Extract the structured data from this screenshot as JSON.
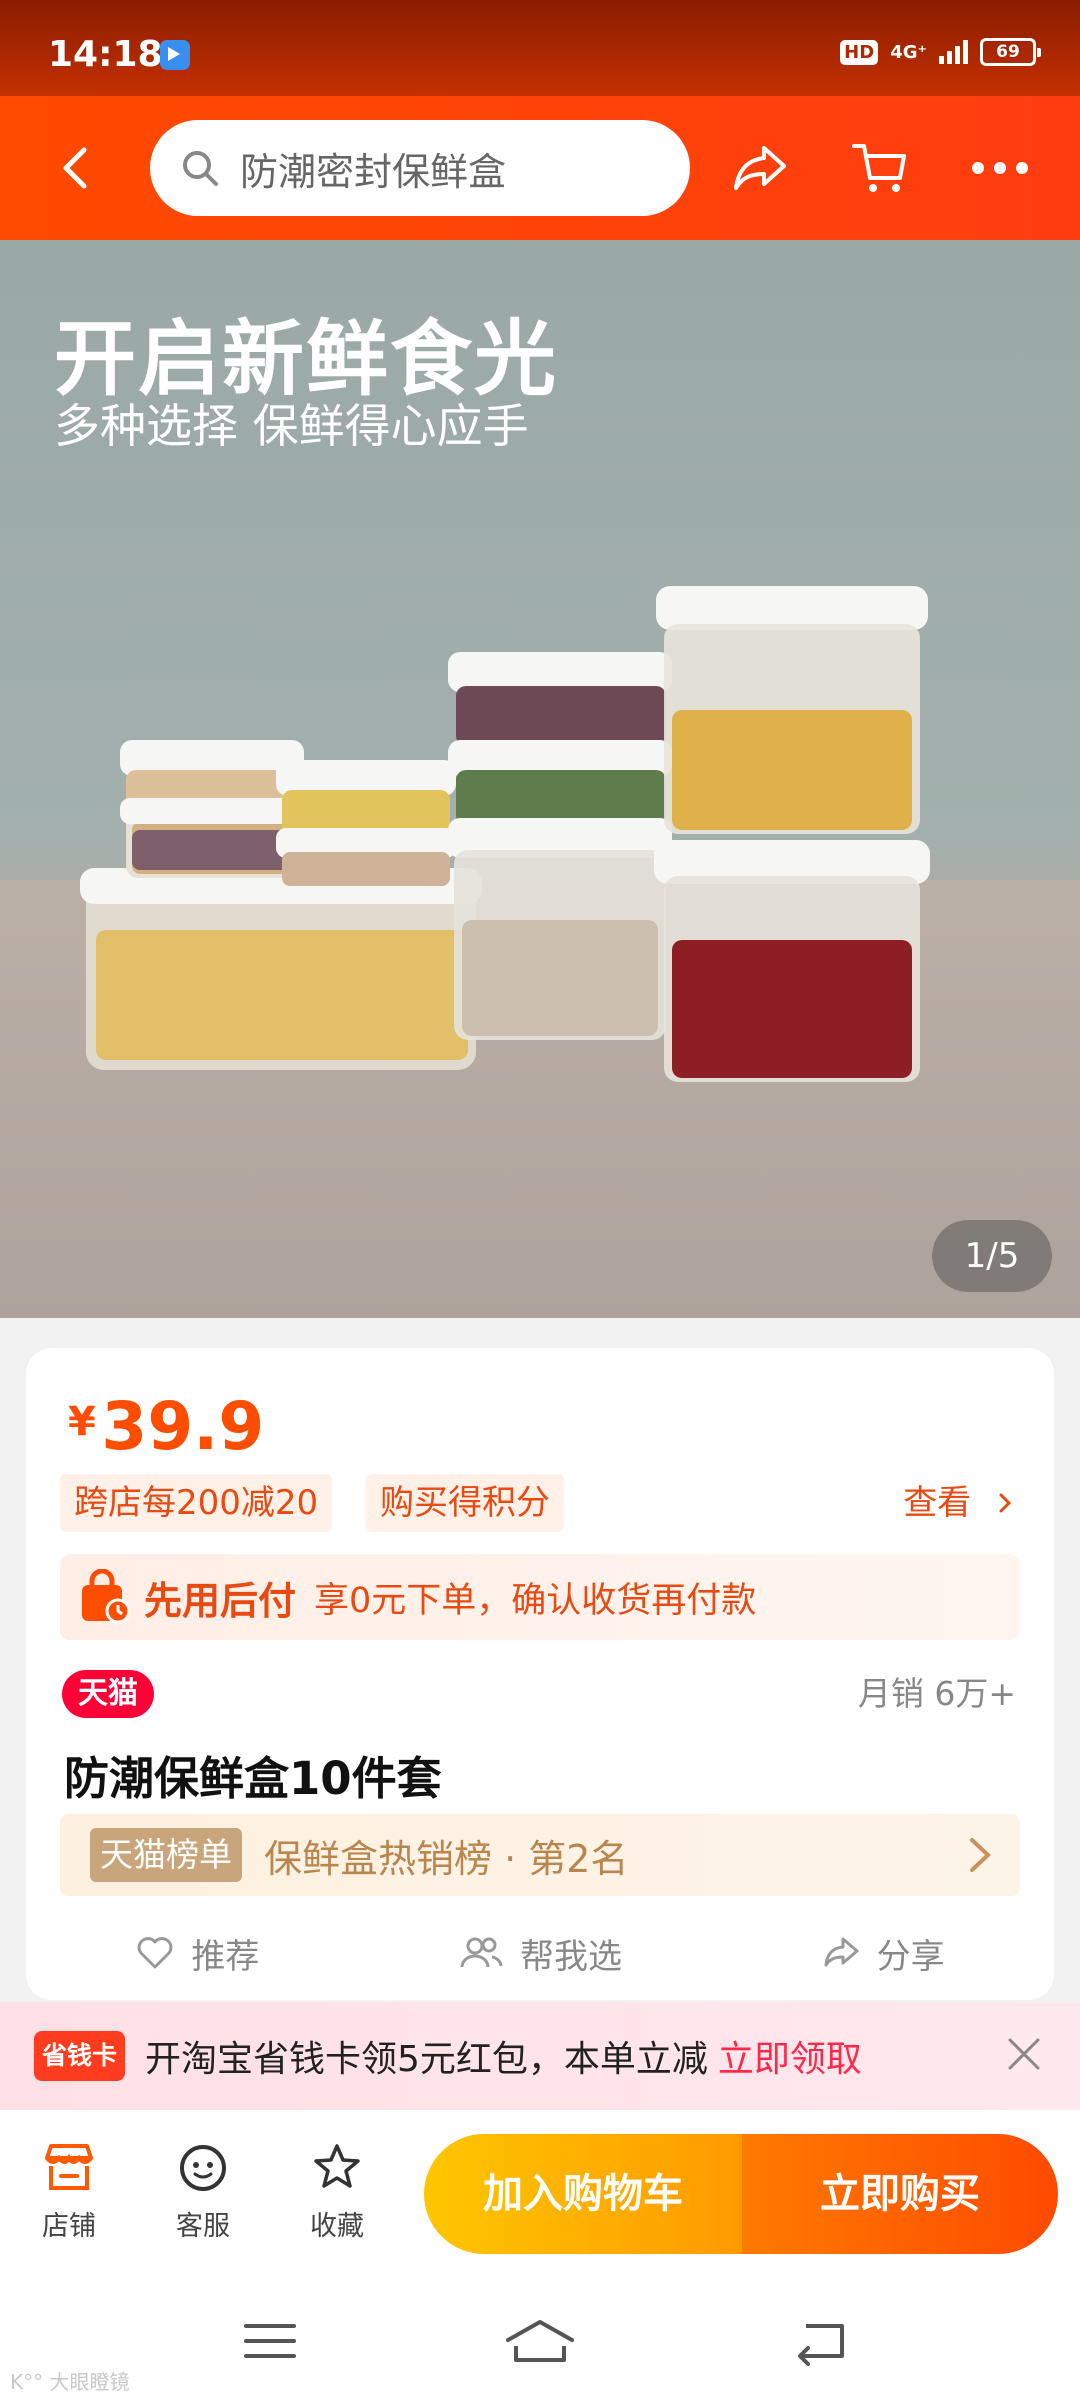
{
  "status_bar": {
    "time": "14:18",
    "hd": "HD",
    "network": "4G⁺",
    "battery": "69"
  },
  "header": {
    "search_text": "防潮密封保鲜盒"
  },
  "hero": {
    "headline": "开启新鲜食光",
    "subline": "多种选择 保鲜得心应手",
    "page_indicator": "1/5"
  },
  "product": {
    "currency": "¥",
    "price": "39.9",
    "tags": [
      "跨店每200减20",
      "购买得积分"
    ],
    "see_label": "查看",
    "pay_later": {
      "title": "先用后付",
      "desc": "享0元下单，确认收货再付款"
    },
    "store_badge": "天猫",
    "monthly_sales": "月销  6万+",
    "title": "防潮保鲜盒10件套",
    "rank": {
      "badge": "天猫榜单",
      "text": "保鲜盒热销榜 · 第2名"
    },
    "actions": {
      "recommend": "推荐",
      "help_choose": "帮我选",
      "share": "分享"
    }
  },
  "promo": {
    "badge": "省钱卡",
    "text": "开淘宝省钱卡领5元红包，本单立减",
    "cta": "立即领取"
  },
  "bottom_bar": {
    "store": "店铺",
    "service": "客服",
    "favorite": "收藏",
    "add_to_cart": "加入购物车",
    "buy_now": "立即购买"
  },
  "colors": {
    "brand_orange": "#ff4a00",
    "price_orange": "#ff4d00",
    "tmall_red": "#ff0036",
    "cart_yellow": "#ffc600"
  },
  "watermark": "K°° 大眼瞪镜"
}
